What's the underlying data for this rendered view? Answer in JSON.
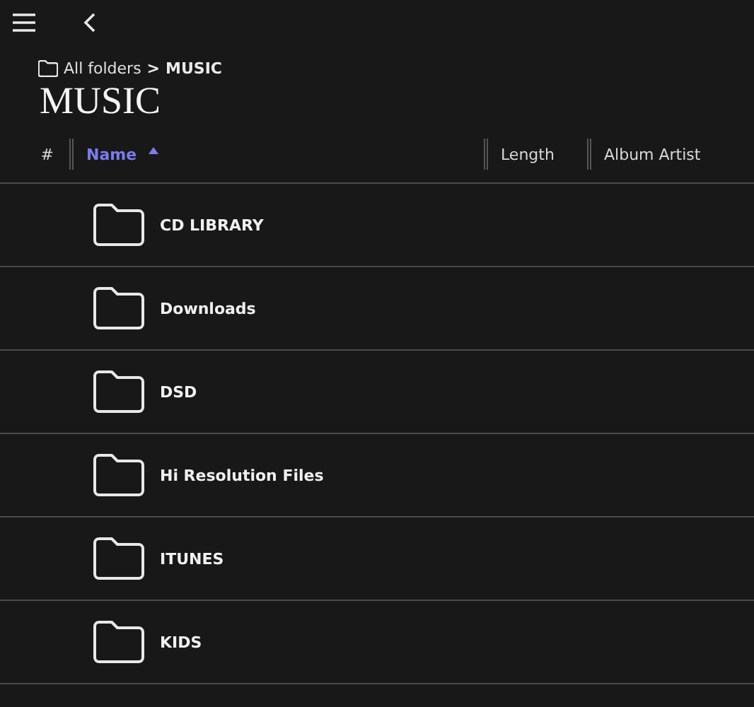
{
  "breadcrumb": {
    "root": "All folders",
    "separator": ">",
    "current": "MUSIC"
  },
  "title": "MUSIC",
  "table": {
    "columns": [
      {
        "label": "#",
        "selected": false,
        "sorted": false
      },
      {
        "label": "Name",
        "selected": true,
        "sorted": true
      },
      {
        "label": "Length",
        "selected": false,
        "sorted": false
      },
      {
        "label": "Album Artist",
        "selected": false,
        "sorted": false
      }
    ],
    "rows": [
      {
        "name": "CD LIBRARY"
      },
      {
        "name": "Downloads"
      },
      {
        "name": "DSD"
      },
      {
        "name": "Hi Resolution Files"
      },
      {
        "name": "ITUNES"
      },
      {
        "name": "KIDS"
      }
    ]
  }
}
